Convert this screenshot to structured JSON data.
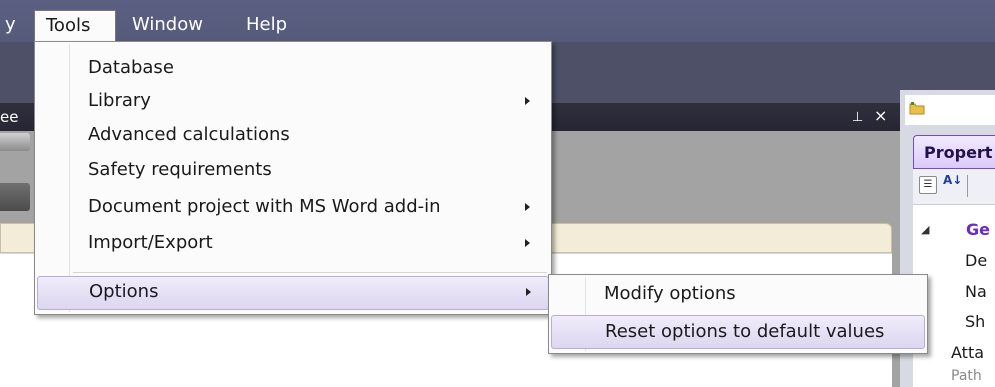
{
  "menubar": {
    "cut_item": "y",
    "tools": "Tools",
    "window": "Window",
    "help": "Help"
  },
  "left_panel": {
    "title_fragment": "ee",
    "pin_icon": "pin-icon",
    "close_icon": "close-icon"
  },
  "tools_menu": {
    "items": [
      {
        "label": "Database",
        "has_submenu": false
      },
      {
        "label": "Library",
        "has_submenu": true
      },
      {
        "label": "Advanced calculations",
        "has_submenu": false
      },
      {
        "label": "Safety requirements",
        "has_submenu": false
      },
      {
        "label": "Document project with MS Word add-in",
        "has_submenu": true
      },
      {
        "label": "Import/Export",
        "has_submenu": true
      },
      {
        "label": "Options",
        "has_submenu": true,
        "highlighted": true
      }
    ]
  },
  "options_submenu": {
    "items": [
      {
        "label": "Modify options",
        "highlighted": false
      },
      {
        "label": "Reset options to default values",
        "highlighted": true
      }
    ]
  },
  "properties_panel": {
    "tab_label": "Propert",
    "icons": [
      "folder-icon",
      "categorized-icon",
      "sort-az-icon"
    ],
    "sort_glyph": "A↓",
    "collapse_glyph": "◢",
    "rows": [
      "Ge",
      "De",
      "Na",
      "Sh",
      "Atta",
      "Path"
    ]
  },
  "colors": {
    "menubar": "#565a7a",
    "menu_background": "#fbfbfb",
    "highlight": "#ddd6f0",
    "properties_accent": "#6a2cc4",
    "panel_dark": "#2a2a37"
  }
}
